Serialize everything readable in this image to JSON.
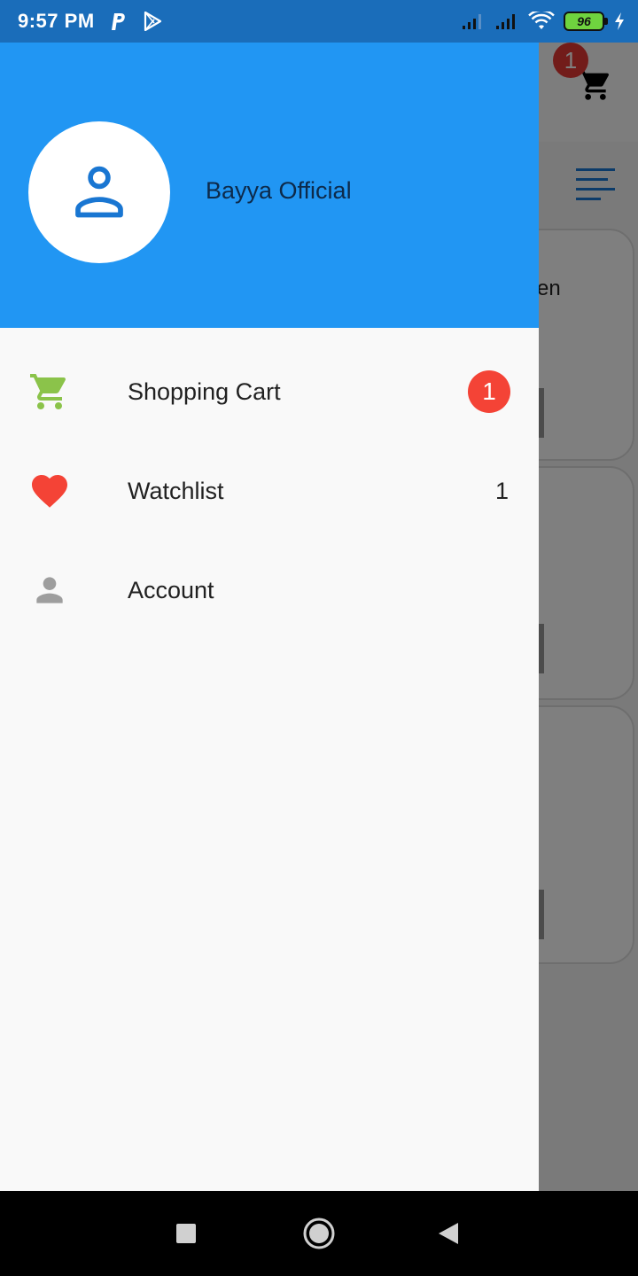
{
  "status_bar": {
    "time": "9:57 PM",
    "battery": "96",
    "left_icons": [
      "paypal-icon",
      "play-store-icon"
    ],
    "right_icons": [
      "signal-icon",
      "signal-icon",
      "wifi-icon",
      "battery-icon",
      "charging-icon"
    ]
  },
  "background": {
    "cart_badge": "1",
    "card_text": "en"
  },
  "drawer": {
    "user_name": "Bayya Official",
    "items": [
      {
        "label": "Shopping Cart",
        "icon": "shopping-cart-icon",
        "badge": "1",
        "color": "#8bc34a"
      },
      {
        "label": "Watchlist",
        "icon": "heart-icon",
        "count": "1",
        "color": "#f44336"
      },
      {
        "label": "Account",
        "icon": "person-icon",
        "color": "#9e9e9e"
      }
    ],
    "header_color": "#2196f3"
  },
  "nav_bar": {
    "buttons": [
      "recents-button",
      "home-button",
      "back-button"
    ]
  }
}
